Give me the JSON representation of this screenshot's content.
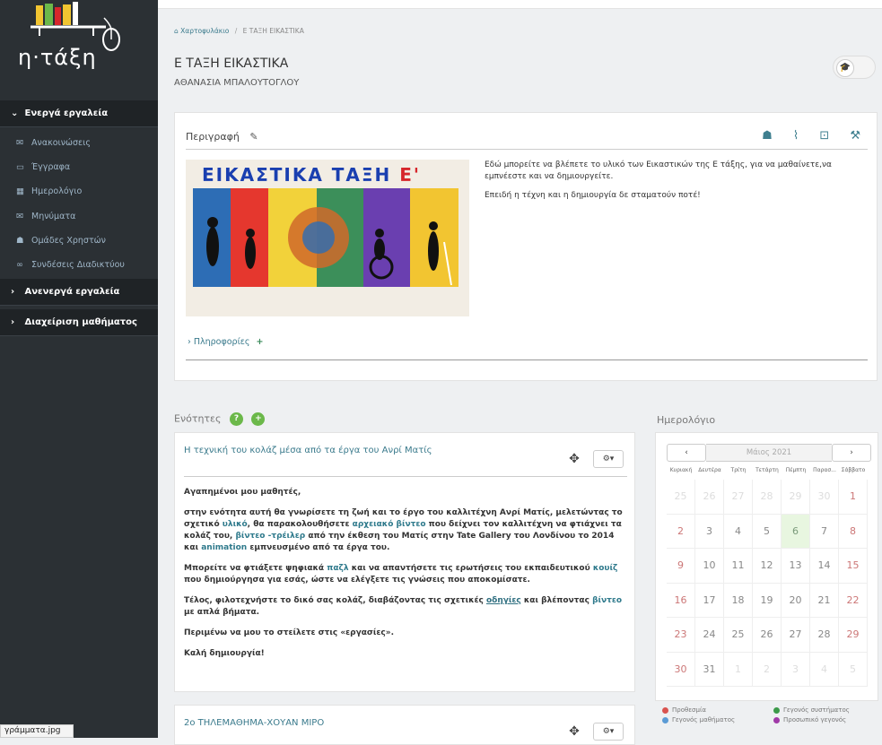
{
  "logo": {
    "text": "η·τάξη"
  },
  "sidebar": {
    "active_header": "Ενεργά εργαλεία",
    "items": [
      {
        "label": "Ανακοινώσεις",
        "icon": "megaphone-icon"
      },
      {
        "label": "Έγγραφα",
        "icon": "folder-icon"
      },
      {
        "label": "Ημερολόγιο",
        "icon": "calendar-icon"
      },
      {
        "label": "Μηνύματα",
        "icon": "envelope-icon"
      },
      {
        "label": "Ομάδες Χρηστών",
        "icon": "users-icon"
      },
      {
        "label": "Συνδέσεις Διαδικτύου",
        "icon": "link-icon"
      }
    ],
    "inactive_header": "Ανενεργά εργαλεία",
    "admin_header": "Διαχείριση μαθήματος"
  },
  "statusbar": {
    "text": "γράμματα.jpg"
  },
  "breadcrumb": {
    "home": "Χαρτοφυλάκιο",
    "current": "Ε ΤΑΞΗ ΕΙΚΑΣΤΙΚΑ"
  },
  "course": {
    "title": "Ε ΤΑΞΗ ΕΙΚΑΣΤΙΚΑ",
    "teacher": "ΑΘΑΝΑΣΙΑ ΜΠΑΛΟΥΤΟΓΛΟΥ"
  },
  "description": {
    "label": "Περιγραφή",
    "image_title": "ΕΙΚΑΣΤΙΚΑ ΤΑΞΗ",
    "image_title_letter": "Ε'",
    "text1": "Εδώ μπορείτε να βλέπετε το υλικό των Εικαστικών της Ε τάξης, για να μαθαίνετε,να εμπνέεστε και να δημιουργείτε.",
    "text2": "Επειδή η τέχνη και η δημιουργία δε σταματούν ποτέ!",
    "info_label": "Πληροφορίες"
  },
  "sections": {
    "label": "Ενότητες",
    "section1": {
      "title": "Η τεχνική του κολάζ μέσα από τα έργα του Ανρί Ματίς",
      "greeting": "Αγαπημένοι μου μαθητές,",
      "p1_a": "στην ενότητα αυτή θα γνωρίσετε τη  ζωή και το έργο του καλλιτέχνη Ανρί Ματίς, μελετώντας το σχετικό ",
      "p1_link1": "υλικό",
      "p1_b": ", θα παρακολουθήσετε ",
      "p1_link2": "αρχειακό βίντεο",
      "p1_c": " που δείχνει τον καλλιτέχνη να φτιάχνει τα κολάζ του, ",
      "p1_link3": "βίντεο -τρέιλερ",
      "p1_d": " από την έκθεση του Ματίς στην Tate Gallery του Λονδίνου το 2014 και ",
      "p1_link4": "animation",
      "p1_e": " εμπνευσμένο από τα έργα του.",
      "p2_a": "Μπορείτε να φτιάξετε ψηφιακά ",
      "p2_link1": "παζλ",
      "p2_b": " και να απαντήσετε τις ερωτήσεις του εκπαιδευτικού ",
      "p2_link2": "κουίζ",
      "p2_c": " που δημιούργησα για εσάς, ώστε να ελέγξετε τις γνώσεις που αποκομίσατε.",
      "p3_a": "Τέλος, φιλοτεχνήστε το δικό σας κολάζ, διαβάζοντας τις σχετικές ",
      "p3_link1": "οδηγίες",
      "p3_b": " και βλέποντας ",
      "p3_link2": "βίντεο",
      "p3_c": " με απλά βήματα.",
      "p4": "Περιμένω να μου το στείλετε στις «εργασίες».",
      "p5": "Καλή δημιουργία!"
    },
    "section2": {
      "title": "2ο ΤΗΛΕΜΑΘΗΜΑ-ΧΟΥΑΝ ΜΙΡΟ"
    },
    "gear_label": "⚙▾"
  },
  "calendar": {
    "label": "Ημερολόγιο",
    "month": "Μάιος 2021",
    "prev": "‹",
    "next": "›",
    "dows": [
      "Κυριακή",
      "Δευτέρα",
      "Τρίτη",
      "Τετάρτη",
      "Πέμπτη",
      "Παρασ...",
      "Σάββατο"
    ],
    "days": [
      25,
      26,
      27,
      28,
      29,
      30,
      1,
      2,
      3,
      4,
      5,
      6,
      7,
      8,
      9,
      10,
      11,
      12,
      13,
      14,
      15,
      16,
      17,
      18,
      19,
      20,
      21,
      22,
      23,
      24,
      25,
      26,
      27,
      28,
      29,
      30,
      31,
      1,
      2,
      3,
      4,
      5
    ],
    "muted_indices": [
      0,
      1,
      2,
      3,
      4,
      5,
      37,
      38,
      39,
      40,
      41
    ],
    "today_index": 11,
    "legend": [
      {
        "label": "Προθεσμία",
        "color": "#d9534f"
      },
      {
        "label": "Γεγονός συστήματος",
        "color": "#3c9a4a"
      },
      {
        "label": "Γεγονός μαθήματος",
        "color": "#5b9bd5"
      },
      {
        "label": "Προσωπικό γεγονός",
        "color": "#a03aa8"
      }
    ]
  },
  "colors": {
    "sidebar": "#2b3034",
    "accent": "#3a7a8c",
    "green": "#6bb84a"
  }
}
